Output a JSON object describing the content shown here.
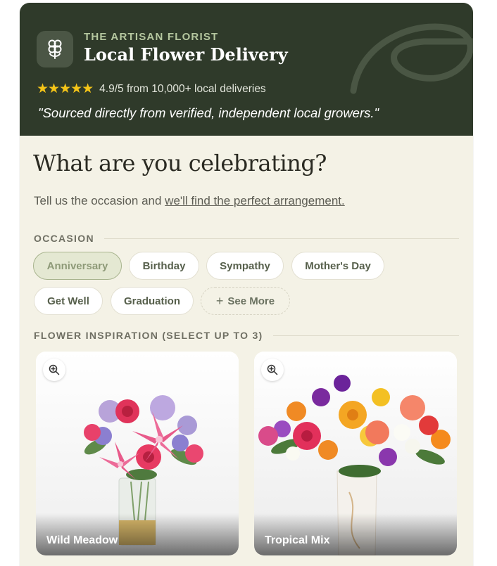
{
  "header": {
    "eyebrow": "THE ARTISAN FLORIST",
    "title": "Local Flower Delivery",
    "stars": "★★★★★",
    "rating_text": "4.9/5 from 10,000+ local deliveries",
    "quote": "\"Sourced directly from verified, independent local growers.\"",
    "logo_icon": "flower-icon"
  },
  "intro": {
    "headline": "What are you celebrating?",
    "subtitle_prefix": "Tell us the occasion and ",
    "subtitle_link": "we'll find the perfect arrangement."
  },
  "occasion": {
    "label": "OCCASION",
    "selected": "Anniversary",
    "options": [
      "Anniversary",
      "Birthday",
      "Sympathy",
      "Mother's Day",
      "Get Well",
      "Graduation"
    ],
    "more_label": "See More"
  },
  "inspiration": {
    "label": "FLOWER INSPIRATION (SELECT UP TO 3)",
    "items": [
      {
        "name": "Wild Meadow",
        "icon": "zoom-in-icon"
      },
      {
        "name": "Tropical Mix",
        "icon": "zoom-in-icon"
      }
    ]
  },
  "colors": {
    "header_bg": "#2f3a2a",
    "page_bg": "#f4f2e6",
    "accent": "#b5c79f",
    "star": "#f5c518"
  }
}
